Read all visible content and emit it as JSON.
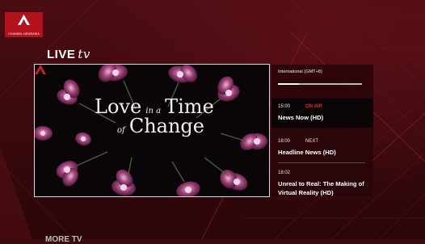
{
  "brand": {
    "logo_text": "CHANNEL NEWSASIA",
    "accent": "#b3121c"
  },
  "live": {
    "title": "LIVE",
    "tv_label": "tv"
  },
  "player": {
    "show_title": {
      "line1": "Love",
      "connector1": "in a",
      "line2": "Time",
      "connector2": "of",
      "line3": "Change"
    },
    "image_description_icon": "orchid-icon"
  },
  "schedule": {
    "timezone": "International (GMT+8)",
    "progress": 0.25,
    "slots": [
      {
        "time": "15:00",
        "state": "ON AIR",
        "name": "News Now (HD)",
        "state_color": "#e0262f"
      },
      {
        "time": "18:00",
        "state": "NEXT",
        "name": "Headline News (HD)",
        "state_color": "#e6e6e6"
      },
      {
        "time": "18:02",
        "state": "",
        "name": "Unreal to Real: The Making of Virtual Reality (HD)",
        "state_color": "#e6e6e6"
      }
    ]
  },
  "bottom": {
    "label": "MORE TV"
  }
}
